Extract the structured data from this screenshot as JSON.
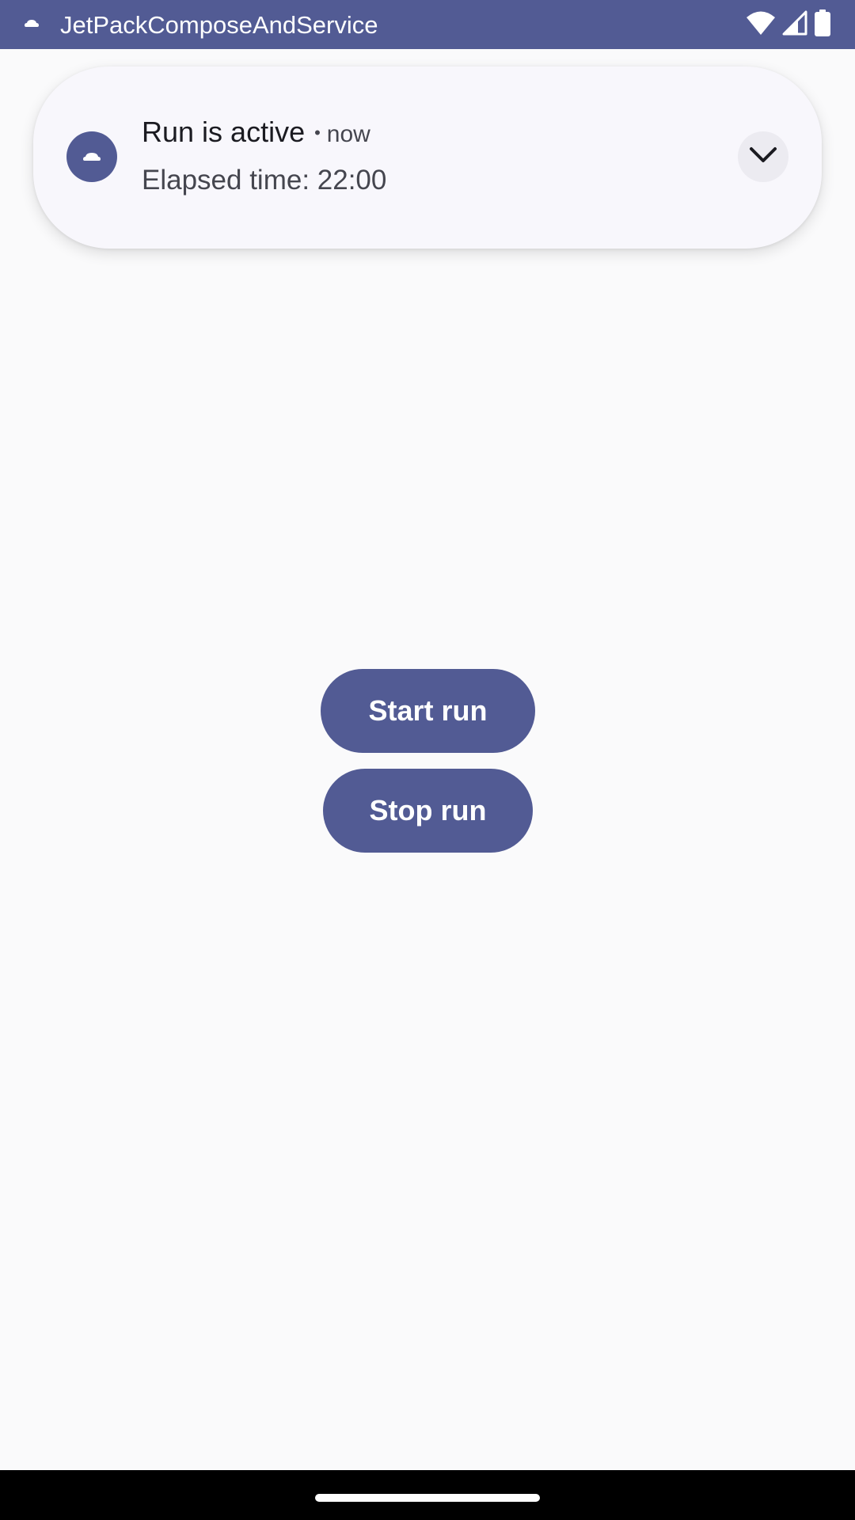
{
  "status_bar": {
    "app_title": "JetPackComposeAndService",
    "app_icon": "cloud-icon",
    "icons": [
      "wifi-icon",
      "signal-icon",
      "battery-icon"
    ],
    "background": "#525B94"
  },
  "notification": {
    "icon": "cloud-icon",
    "title": "Run is active",
    "separator": "•",
    "time": "now",
    "body": "Elapsed time: 22:00",
    "expand_icon": "chevron-down-icon"
  },
  "buttons": {
    "start_label": "Start run",
    "stop_label": "Stop run",
    "color": "#525B94"
  },
  "nav_bar": {
    "handle": "home-gesture-handle"
  }
}
